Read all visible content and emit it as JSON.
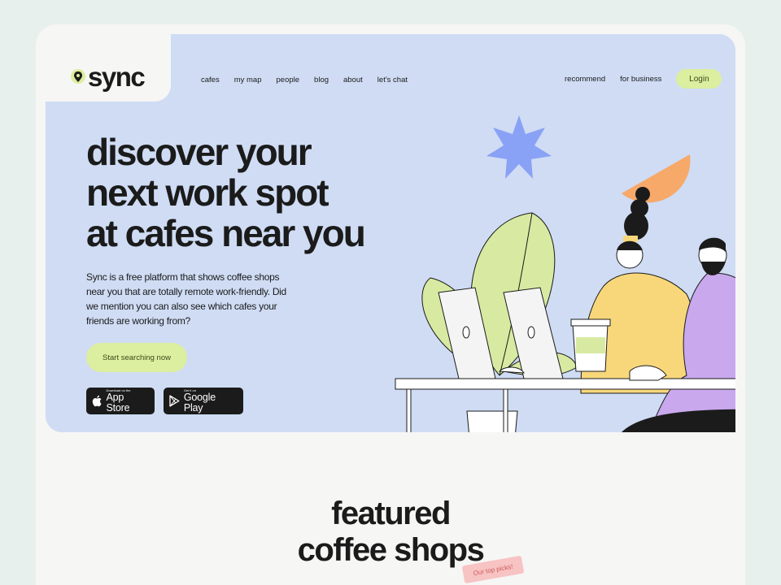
{
  "brand": {
    "name": "sync"
  },
  "nav": {
    "left": [
      "cafes",
      "my map",
      "people",
      "blog",
      "about",
      "let's chat"
    ],
    "right": [
      "recommend",
      "for business"
    ],
    "login": "Login"
  },
  "hero": {
    "headline": [
      "discover your",
      "next work spot",
      "at cafes near you"
    ],
    "description": "Sync is a free platform that shows coffee shops near you that are totally remote work-friendly. Did we mention you can also see which cafes your friends are working from?",
    "cta": "Start searching now",
    "app_store": {
      "sub": "Download on the",
      "main": "App Store"
    },
    "google_play": {
      "sub": "Get it on",
      "main": "Google Play"
    }
  },
  "featured": {
    "title": [
      "featured",
      "coffee shops"
    ],
    "tag": "Our top picks!"
  },
  "colors": {
    "hero_bg": "#cfdcf4",
    "accent_lime": "#dcee9f",
    "star": "#8aa2f5",
    "semicircle": "#f7a96a",
    "purple": "#c9a8ee",
    "yellow": "#f8d77b"
  }
}
